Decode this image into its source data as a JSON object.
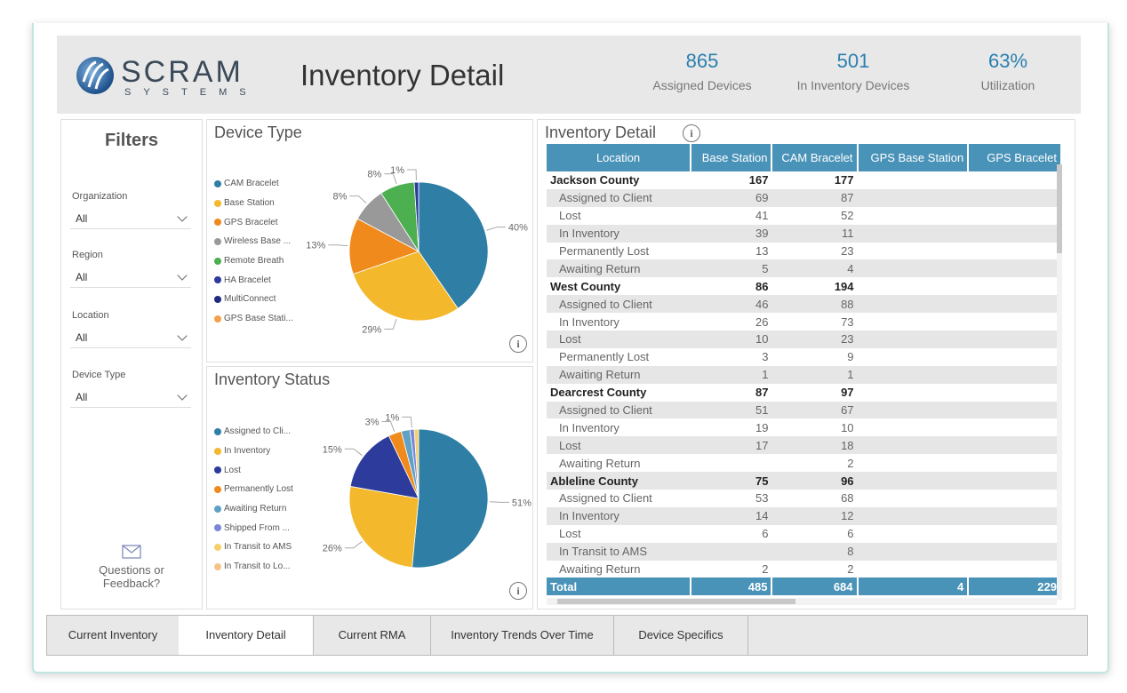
{
  "header": {
    "logo_text": "SCRAM",
    "logo_sub": "SYSTEMS",
    "title": "Inventory Detail",
    "kpis": [
      {
        "value": "865",
        "label": "Assigned Devices"
      },
      {
        "value": "501",
        "label": "In Inventory Devices"
      },
      {
        "value": "63%",
        "label": "Utilization"
      }
    ]
  },
  "filters": {
    "title": "Filters",
    "fields": [
      {
        "label": "Organization",
        "value": "All"
      },
      {
        "label": "Region",
        "value": "All"
      },
      {
        "label": "Location",
        "value": "All"
      },
      {
        "label": "Device Type",
        "value": "All"
      }
    ],
    "feedback_line1": "Questions or",
    "feedback_line2": "Feedback?"
  },
  "device_type": {
    "title": "Device Type",
    "legend": [
      {
        "label": "CAM Bracelet",
        "color": "#2e7ea6"
      },
      {
        "label": "Base Station",
        "color": "#f3b82c"
      },
      {
        "label": "GPS Bracelet",
        "color": "#f08a1c"
      },
      {
        "label": "Wireless Base ...",
        "color": "#999999"
      },
      {
        "label": "Remote Breath",
        "color": "#4caf50"
      },
      {
        "label": "HA Bracelet",
        "color": "#2c3b9c"
      },
      {
        "label": "MultiConnect",
        "color": "#1f2a80"
      },
      {
        "label": "GPS Base Stati...",
        "color": "#f5a04a"
      }
    ]
  },
  "inventory_status": {
    "title": "Inventory Status",
    "legend": [
      {
        "label": "Assigned to Cli...",
        "color": "#2e7ea6"
      },
      {
        "label": "In Inventory",
        "color": "#f3b82c"
      },
      {
        "label": "Lost",
        "color": "#2c3b9c"
      },
      {
        "label": "Permanently Lost",
        "color": "#f08a1c"
      },
      {
        "label": "Awaiting Return",
        "color": "#5fa2c6"
      },
      {
        "label": "Shipped From ...",
        "color": "#7b86d6"
      },
      {
        "label": "In Transit to AMS",
        "color": "#f6d06a"
      },
      {
        "label": "In Transit to Lo...",
        "color": "#f3c48a"
      }
    ]
  },
  "chart_data": [
    {
      "type": "pie",
      "title": "Device Type",
      "categories": [
        "CAM Bracelet",
        "Base Station",
        "GPS Bracelet",
        "Wireless Base ...",
        "Remote Breath",
        "HA Bracelet"
      ],
      "values": [
        40,
        29,
        13,
        8,
        8,
        1
      ],
      "labels": [
        "40%",
        "29%",
        "13%",
        "8%",
        "8%",
        "1%"
      ],
      "colors": [
        "#2e7ea6",
        "#f3b82c",
        "#f08a1c",
        "#999999",
        "#4caf50",
        "#2c3b9c"
      ]
    },
    {
      "type": "pie",
      "title": "Inventory Status",
      "categories": [
        "Assigned to Cli...",
        "In Inventory",
        "Lost",
        "Permanently Lost",
        "Awaiting Return",
        "Shipped From ...",
        "In Transit to AMS"
      ],
      "values": [
        51,
        26,
        15,
        3,
        2,
        1,
        1
      ],
      "labels": [
        "51%",
        "26%",
        "15%",
        "3%",
        "",
        "1%",
        ""
      ],
      "colors": [
        "#2e7ea6",
        "#f3b82c",
        "#2c3b9c",
        "#f08a1c",
        "#5fa2c6",
        "#7b86d6",
        "#f6d06a"
      ]
    }
  ],
  "table": {
    "title": "Inventory Detail",
    "columns": [
      "Location",
      "Base Station",
      "CAM Bracelet",
      "GPS Base Station",
      "GPS Bracelet"
    ],
    "rows": [
      {
        "type": "group",
        "cells": [
          "Jackson County",
          "167",
          "177",
          "",
          ""
        ]
      },
      {
        "type": "sub",
        "cells": [
          "Assigned to Client",
          "69",
          "87",
          "",
          ""
        ]
      },
      {
        "type": "sub",
        "cells": [
          "Lost",
          "41",
          "52",
          "",
          ""
        ]
      },
      {
        "type": "sub",
        "cells": [
          "In Inventory",
          "39",
          "11",
          "",
          ""
        ]
      },
      {
        "type": "sub",
        "cells": [
          "Permanently Lost",
          "13",
          "23",
          "",
          ""
        ]
      },
      {
        "type": "sub",
        "cells": [
          "Awaiting Return",
          "5",
          "4",
          "",
          ""
        ]
      },
      {
        "type": "group",
        "cells": [
          "West County",
          "86",
          "194",
          "",
          ""
        ]
      },
      {
        "type": "sub",
        "cells": [
          "Assigned to Client",
          "46",
          "88",
          "",
          ""
        ]
      },
      {
        "type": "sub",
        "cells": [
          "In Inventory",
          "26",
          "73",
          "",
          ""
        ]
      },
      {
        "type": "sub",
        "cells": [
          "Lost",
          "10",
          "23",
          "",
          ""
        ]
      },
      {
        "type": "sub",
        "cells": [
          "Permanently Lost",
          "3",
          "9",
          "",
          ""
        ]
      },
      {
        "type": "sub",
        "cells": [
          "Awaiting Return",
          "1",
          "1",
          "",
          ""
        ]
      },
      {
        "type": "group",
        "cells": [
          "Dearcrest County",
          "87",
          "97",
          "",
          ""
        ]
      },
      {
        "type": "sub",
        "cells": [
          "Assigned to Client",
          "51",
          "67",
          "",
          ""
        ]
      },
      {
        "type": "sub",
        "cells": [
          "In Inventory",
          "19",
          "10",
          "",
          ""
        ]
      },
      {
        "type": "sub",
        "cells": [
          "Lost",
          "17",
          "18",
          "",
          ""
        ]
      },
      {
        "type": "sub",
        "cells": [
          "Awaiting Return",
          "",
          "2",
          "",
          ""
        ]
      },
      {
        "type": "group",
        "cells": [
          "Ableline County",
          "75",
          "96",
          "",
          ""
        ]
      },
      {
        "type": "sub",
        "cells": [
          "Assigned to Client",
          "53",
          "68",
          "",
          ""
        ]
      },
      {
        "type": "sub",
        "cells": [
          "In Inventory",
          "14",
          "12",
          "",
          ""
        ]
      },
      {
        "type": "sub",
        "cells": [
          "Lost",
          "6",
          "6",
          "",
          ""
        ]
      },
      {
        "type": "sub",
        "cells": [
          "In Transit to AMS",
          "",
          "8",
          "",
          ""
        ]
      },
      {
        "type": "sub",
        "cells": [
          "Awaiting Return",
          "2",
          "2",
          "",
          ""
        ]
      }
    ],
    "total": [
      "Total",
      "485",
      "684",
      "4",
      "229"
    ]
  },
  "tabs": [
    {
      "label": "Current Inventory",
      "active": false
    },
    {
      "label": "Inventory Detail",
      "active": true
    },
    {
      "label": "Current RMA",
      "active": false
    },
    {
      "label": "Inventory Trends Over Time",
      "active": false
    },
    {
      "label": "Device Specifics",
      "active": false
    }
  ]
}
